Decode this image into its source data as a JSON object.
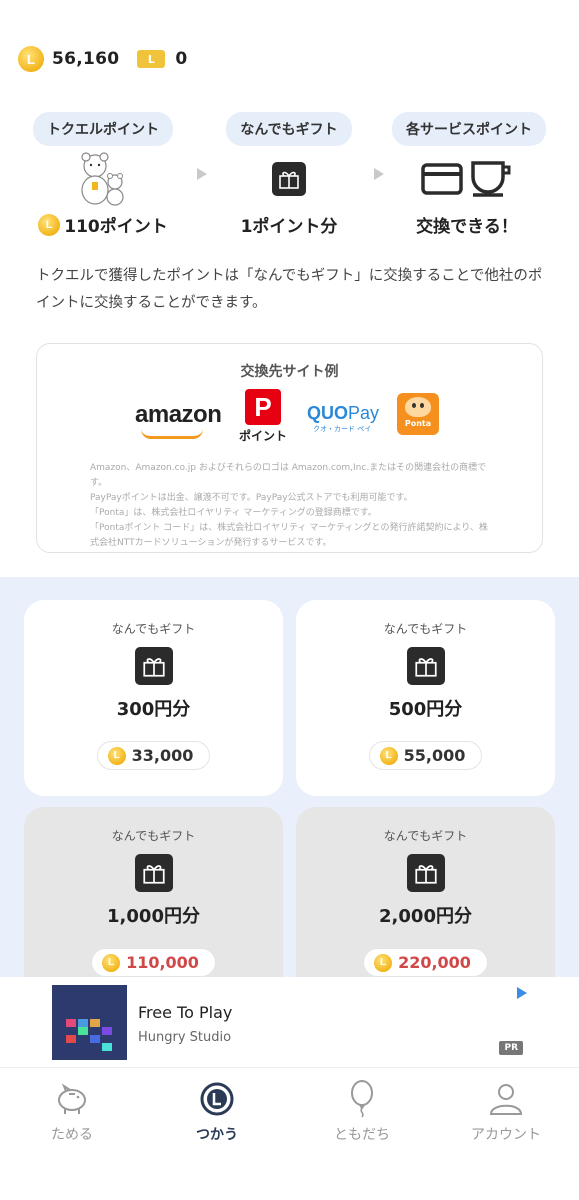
{
  "header": {
    "coin_symbol": "L",
    "points": "56,160",
    "ticket_symbol": "L",
    "tickets": "0"
  },
  "flow": {
    "steps": [
      {
        "pill": "トクエルポイント",
        "caption": "110ポイント",
        "icon": "bear-mascots-icon"
      },
      {
        "pill": "なんでもギフト",
        "caption": "1ポイント分",
        "icon": "gift-icon"
      },
      {
        "pill": "各サービスポイント",
        "caption": "交換できる！",
        "icon": "card-and-cup-icon"
      }
    ]
  },
  "description": "トクエルで獲得したポイントは「なんでもギフト」に交換することで他社のポイントに交換することができます。",
  "partners": {
    "title": "交換先サイト例",
    "amazon": "amazon",
    "paypay_letter": "P",
    "paypay_text": "ポイント",
    "quo_main": "QUO",
    "quo_sub": "Pay",
    "quo_small": "クオ・カード ペイ",
    "ponta_text": "Ponta",
    "legal": [
      "Amazon、Amazon.co.jp およびそれらのロゴは Amazon.com,Inc.またはその関連会社の商標です。",
      "PayPayポイントは出金、譲渡不可です。PayPay公式ストアでも利用可能です。",
      "「Ponta」は、株式会社ロイヤリティ マーケティングの登録商標です。",
      "「Pontaポイント コード」は、株式会社ロイヤリティ マーケティングとの発行許諾契約により、株式会社NTTカードソリューションが発行するサービスです。"
    ]
  },
  "gifts": [
    {
      "label": "なんでもギフト",
      "amount": "300円分",
      "price": "33,000",
      "available": true
    },
    {
      "label": "なんでもギフト",
      "amount": "500円分",
      "price": "55,000",
      "available": true
    },
    {
      "label": "なんでもギフト",
      "amount": "1,000円分",
      "price": "110,000",
      "available": false
    },
    {
      "label": "なんでもギフト",
      "amount": "2,000円分",
      "price": "220,000",
      "available": false
    }
  ],
  "ad": {
    "title": "Free To Play",
    "advertiser": "Hungry Studio",
    "badge": "PR"
  },
  "tabs": [
    {
      "label": "ためる",
      "icon": "piggy-bank-icon",
      "active": false
    },
    {
      "label": "つかう",
      "icon": "coin-icon",
      "active": true
    },
    {
      "label": "ともだち",
      "icon": "balloon-icon",
      "active": false
    },
    {
      "label": "アカウント",
      "icon": "person-icon",
      "active": false
    }
  ],
  "colors": {
    "accent_coin": "#f2b51c",
    "grid_bg": "#e9f0fb",
    "price_red": "#d04848",
    "active_tab": "#2b3a55"
  }
}
